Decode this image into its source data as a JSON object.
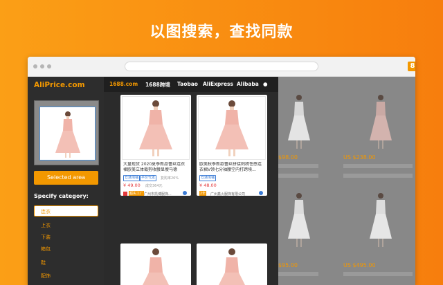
{
  "headline": "以图搜索，查找同款",
  "extension_icon_label": "8",
  "menu_glyph": "⋮",
  "brand": "AliPrice.com",
  "selected_area_label": "Selected area",
  "specify_category_label": "Specify category:",
  "categories": [
    "连衣",
    "上衣",
    "下装",
    "箱包",
    "鞋",
    "配饰"
  ],
  "tabs": [
    "1688.com",
    "1688跨境",
    "Taobao",
    "AliExpress",
    "Alibaba"
  ],
  "results": [
    {
      "title": "大量现货 2020夏季新品蕾丝连衣裙欧美立体裁剪收腰显瘦马德",
      "badges": [
        "仓通淘铺",
        "平价代发"
      ],
      "rebuy": "复购率26%",
      "price": "¥ 49.00",
      "sold": "成交364元",
      "seller_tag": "超实工厂",
      "seller": "广州市凯博服饰..."
    },
    {
      "title": "欧美秋季新款蕾丝拼接刺绣性感连衣裙V领七分袖腰空内打跨境...",
      "badges": [
        "仓通淘铺"
      ],
      "rebuy": "",
      "price": "¥ 48.00",
      "sold": "",
      "seller_tag": "2年",
      "seller": "广州鑫火服饰有限公司"
    }
  ],
  "page_prices": [
    "$98.00",
    "US $238.00",
    "$95.00",
    "US $495.00"
  ],
  "colors": {
    "accent": "#f39800",
    "panel_dark": "#2d2d2d",
    "price_red": "#e4393c"
  }
}
